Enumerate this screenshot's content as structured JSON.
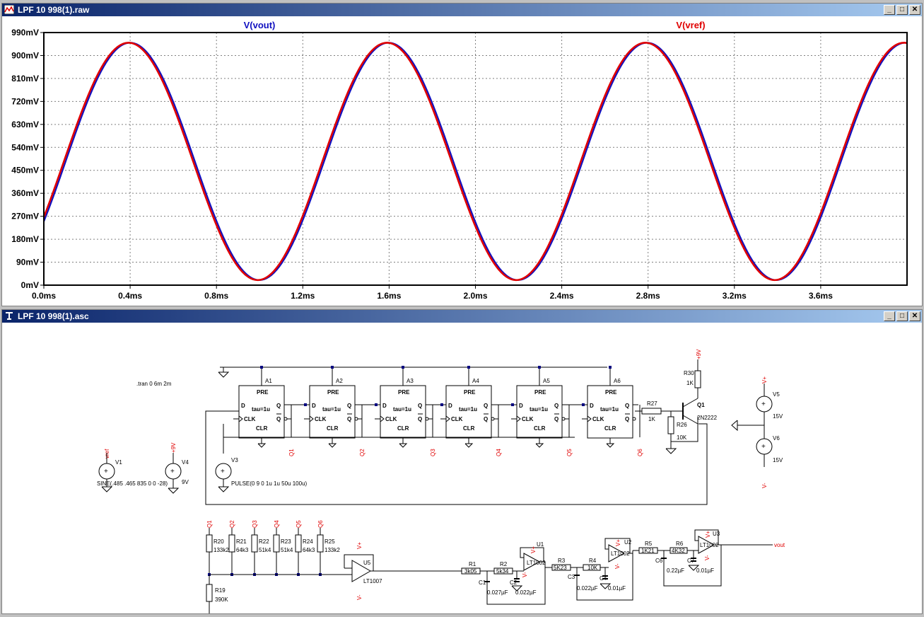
{
  "waveform_window": {
    "title": "LPF 10 998(1).raw",
    "buttons": {
      "minimize": "_",
      "maximize": "□",
      "close": "✕"
    }
  },
  "schematic_window": {
    "title": "LPF 10 998(1).asc",
    "buttons": {
      "minimize": "_",
      "maximize": "□",
      "close": "✕"
    }
  },
  "colors": {
    "vout": "#1010c0",
    "vref": "#e00000",
    "grid": "#808080",
    "wire": "#000080",
    "label": "#e00000"
  },
  "chart_data": {
    "type": "line",
    "x_ticks": [
      "0.0ms",
      "0.4ms",
      "0.8ms",
      "1.2ms",
      "1.6ms",
      "2.0ms",
      "2.4ms",
      "2.8ms",
      "3.2ms",
      "3.6ms"
    ],
    "y_ticks": [
      "0mV",
      "90mV",
      "180mV",
      "270mV",
      "360mV",
      "450mV",
      "540mV",
      "630mV",
      "720mV",
      "810mV",
      "900mV",
      "990mV"
    ],
    "xlim_ms": [
      0,
      4.0
    ],
    "ylim_mV": [
      0,
      990
    ],
    "grid": true,
    "series": [
      {
        "name": "V(vout)",
        "color": "#1010c0",
        "offset_mV": 485,
        "amplitude_mV": 465,
        "frequency_Hz": 835,
        "phase_deg": -28,
        "lag_ms": 0.008
      },
      {
        "name": "V(vref)",
        "color": "#e00000",
        "offset_mV": 485,
        "amplitude_mV": 465,
        "frequency_Hz": 835,
        "phase_deg": -28,
        "lag_ms": 0
      }
    ]
  },
  "schematic": {
    "directive": ".tran 0 6m 2m",
    "flipflops": [
      {
        "name": "A1"
      },
      {
        "name": "A2"
      },
      {
        "name": "A3"
      },
      {
        "name": "A4"
      },
      {
        "name": "A5"
      },
      {
        "name": "A6"
      }
    ],
    "ff_pins": {
      "pre": "PRE",
      "d": "D",
      "q": "Q",
      "clk": "CLK",
      "qbar": "Q",
      "clr": "CLR",
      "tau": "tau=1u"
    },
    "q_labels": [
      "Q1",
      "Q2",
      "Q3",
      "Q4",
      "Q5",
      "Q6"
    ],
    "sources": {
      "v1": {
        "name": "V1",
        "net": "vref",
        "value": "SINE(.485 .465 835 0 0 -28)"
      },
      "v4": {
        "name": "V4",
        "net": "+9V",
        "value": "9V"
      },
      "v3": {
        "name": "V3",
        "value": "PULSE(0 9 0 1u 1u 50u 100u)"
      },
      "v5": {
        "name": "V5",
        "value": "15V",
        "net": "V+"
      },
      "v6": {
        "name": "V6",
        "value": "15V",
        "net": "V-"
      }
    },
    "transistor": {
      "name": "Q1",
      "model": "2N2222"
    },
    "r27": {
      "name": "R27",
      "value": "1K"
    },
    "r26": {
      "name": "R26",
      "value": "10K"
    },
    "r30": {
      "name": "R30",
      "value": "1K",
      "net": "+9V"
    },
    "summing_resistors": [
      {
        "name": "R20",
        "value": "133k2",
        "net": "Q1"
      },
      {
        "name": "R21",
        "value": "64k3",
        "net": "Q2"
      },
      {
        "name": "R22",
        "value": "51k4",
        "net": "Q3"
      },
      {
        "name": "R23",
        "value": "51k4",
        "net": "Q4"
      },
      {
        "name": "R24",
        "value": "64k3",
        "net": "Q5"
      },
      {
        "name": "R25",
        "value": "133k2",
        "net": "Q6"
      }
    ],
    "r19": {
      "name": "R19",
      "value": "390K"
    },
    "u5": {
      "name": "U5",
      "model": "LT1007"
    },
    "filter": {
      "r1": {
        "name": "R1",
        "value": "3k05"
      },
      "r2": {
        "name": "R2",
        "value": "5k34"
      },
      "c1": {
        "name": "C1",
        "value": "0.027µF"
      },
      "c2": {
        "name": "C2",
        "value": "0.022µF"
      },
      "u1": {
        "name": "U1",
        "model": "LT1002"
      },
      "r3": {
        "name": "R3",
        "value": "5K23"
      },
      "r4": {
        "name": "R4",
        "value": "10K"
      },
      "c3": {
        "name": "C3",
        "value": "0.022µF"
      },
      "c4": {
        "name": "C4",
        "value": "0.01µF"
      },
      "u2": {
        "name": "U2",
        "model": "LT1002"
      },
      "r5": {
        "name": "R5",
        "value": "1K21"
      },
      "r6": {
        "name": "R6",
        "value": "4K32"
      },
      "c6": {
        "name": "C6",
        "value": "0.22µF"
      },
      "c7": {
        "name": "C7",
        "value": "0.01µF"
      },
      "u3": {
        "name": "U3",
        "model": "LT1002"
      }
    },
    "vout_label": "vout",
    "vplus": "V+",
    "vminus": "V-"
  }
}
